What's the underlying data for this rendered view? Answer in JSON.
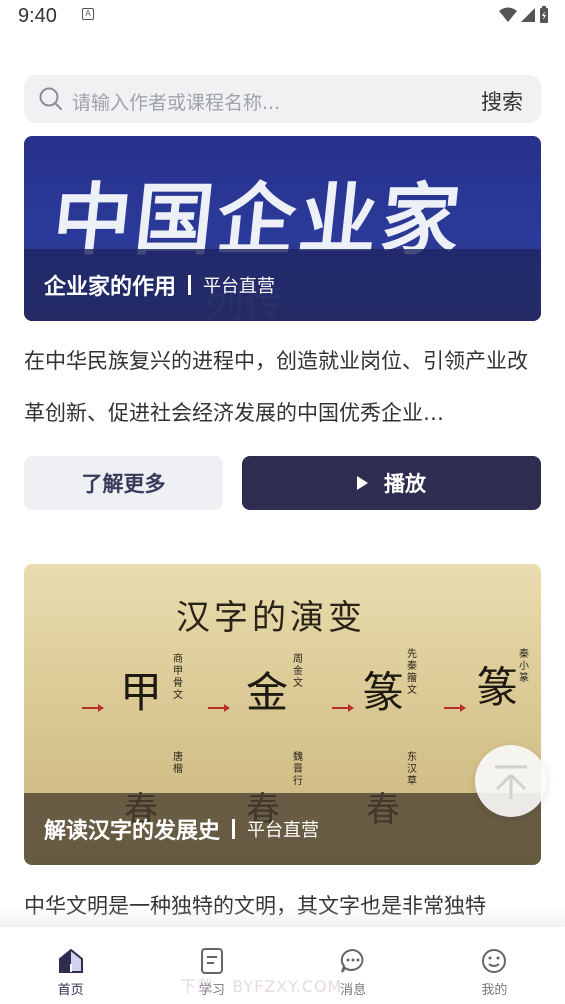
{
  "status_bar": {
    "time": "9:40",
    "notification_badge": "A"
  },
  "search": {
    "placeholder": "请输入作者或课程名称...",
    "button_label": "搜索"
  },
  "courses": [
    {
      "banner_text": "中国企业家",
      "banner_faint_text": "列传",
      "title": "企业家的作用",
      "tag": "平台直营",
      "description": "在中华民族复兴的进程中，创造就业岗位、引领产业改革创新、促进社会经济发展的中国优秀企业…",
      "more_label": "了解更多",
      "play_label": "播放"
    },
    {
      "banner_heading": "汉字的演变",
      "glyphs": [
        "甲",
        "金",
        "篆",
        "篆"
      ],
      "script_labels": [
        "商甲骨文",
        "周金文",
        "先秦籀文",
        "秦小篆",
        "唐楷",
        "魏晋行",
        "东汉草"
      ],
      "lower_glyphs": [
        "春",
        "春",
        "春"
      ],
      "title": "解读汉字的发展史",
      "tag": "平台直营",
      "description": "中华文明是一种独特的文明，其文字也是非常独特"
    }
  ],
  "tabs": [
    {
      "label": "首页",
      "icon": "home-icon",
      "active": true
    },
    {
      "label": "学习",
      "icon": "document-icon",
      "active": false
    },
    {
      "label": "消息",
      "icon": "chat-bubble-icon",
      "active": false
    },
    {
      "label": "我的",
      "icon": "smiley-icon",
      "active": false
    }
  ],
  "watermark": "下载 · BYFZXY.COM",
  "colors": {
    "accent": "#2e2d4f",
    "secondary_button": "#eef0f4",
    "search_bg": "#f0f1f3"
  }
}
